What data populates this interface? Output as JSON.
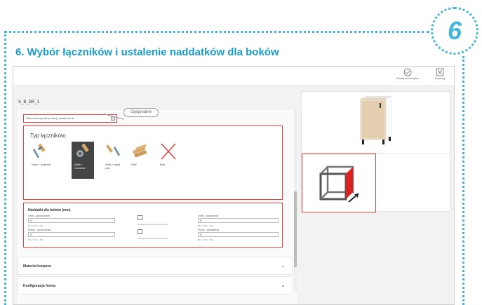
{
  "step_number": "6",
  "headline": "6. Wybór łączników i ustalenie naddatków dla boków",
  "toolbar": {
    "add_to_cart_label": "Dodaj do koszyka",
    "close_label": "Zamknij"
  },
  "cabinet_name": "S_B_DR_1",
  "same_connectors_label": "Takie same łączniki po lewej i prawej stronie",
  "optional_callout": "Opcjonalne",
  "connectors": {
    "title": "Typ łączników:",
    "items": [
      {
        "label": "Kołek + konfirmat"
      },
      {
        "label": "Kołek + mimośród"
      },
      {
        "label": "Kołek + wkręt euro"
      },
      {
        "label": "Kołki"
      },
      {
        "label": "Brak"
      }
    ]
  },
  "allowances": {
    "title": "Naddatki dla boków (mm)",
    "left_lower_label": "Lewy - opuszczenie:",
    "left_lower_value": "0",
    "left_lower_hint": "Min: 0 Max: 100",
    "right_lower_label": "Prawy - opuszczenie:",
    "right_lower_value": "0",
    "right_lower_hint": "Min: 0 Max: 100",
    "check_1_label": "Podbuj wartość wysokości nóżek",
    "check_2_label": "Podbuj wartość wysokości nóżek",
    "left_upper_label": "Lewy - wydłużenie:",
    "left_upper_value": "0",
    "left_upper_hint": "Min: 0 Max: 100",
    "right_upper_label": "Prawy - wydłużenie:",
    "right_upper_value": "0",
    "right_upper_hint": "Min: 0 Max: 100"
  },
  "accordions": [
    {
      "label": "Materiał korpusu"
    },
    {
      "label": "Konfiguracja frontu"
    }
  ],
  "colors": {
    "accent": "#1a9bc9",
    "highlight": "#e8413f",
    "selected_card": "#444444"
  }
}
